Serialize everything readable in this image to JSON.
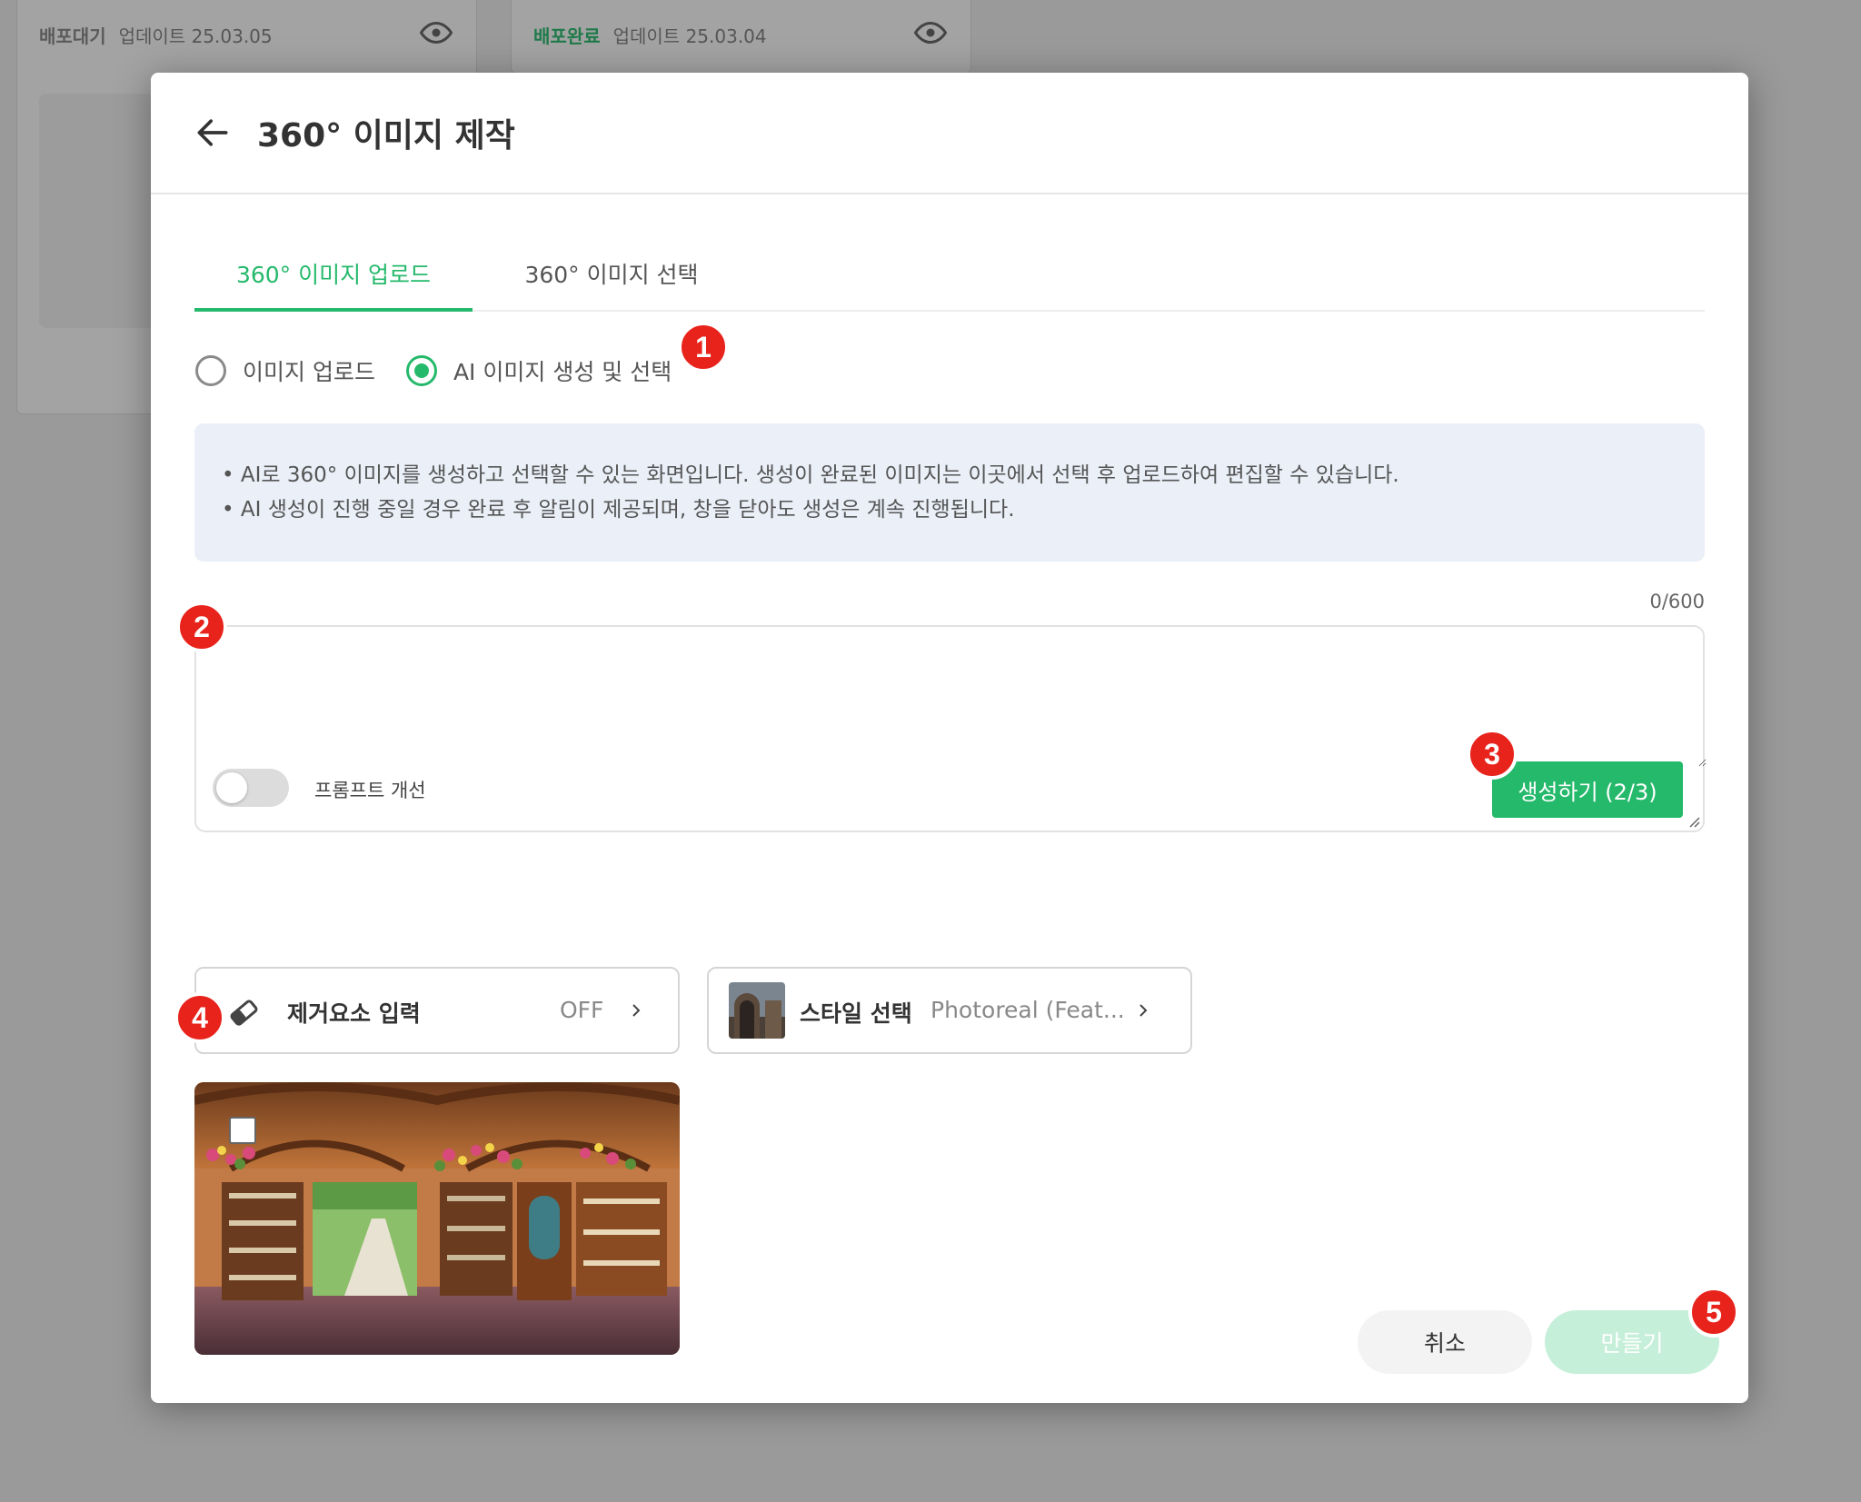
{
  "background": {
    "cards": [
      {
        "status": "배포대기",
        "status_color": "#5a5a5a",
        "date": "업데이트 25.03.05"
      },
      {
        "status": "배포완료",
        "status_color": "#1f7a4a",
        "date": "업데이트 25.03.04"
      }
    ]
  },
  "modal": {
    "title": "360° 이미지 제작",
    "tabs": [
      {
        "label": "360° 이미지 업로드",
        "active": true
      },
      {
        "label": "360° 이미지 선택",
        "active": false
      }
    ],
    "radio_options": [
      {
        "label": "이미지 업로드",
        "checked": false
      },
      {
        "label": "AI 이미지 생성 및 선택",
        "checked": true
      }
    ],
    "info_lines": [
      "• AI로 360° 이미지를 생성하고 선택할 수 있는 화면입니다. 생성이 완료된 이미지는 이곳에서 선택 후 업로드하여 편집할 수 있습니다.",
      "• AI 생성이 진행 중일 경우 완료 후 알림이 제공되며, 창을 닫아도 생성은 계속 진행됩니다."
    ],
    "prompt": {
      "value": "",
      "char_count": "0/600",
      "toggle_label": "프롬프트 개선",
      "toggle_on": false,
      "generate_label": "생성하기 (2/3)"
    },
    "remove_elements": {
      "label": "제거요소 입력",
      "value": "OFF",
      "icon": "eraser-icon"
    },
    "style_select": {
      "label": "스타일 선택",
      "value": "Photoreal (Feat..."
    },
    "generated_image": {
      "description_icon": "panorama-image",
      "selected": false
    },
    "cancel_label": "취소",
    "create_label": "만들기"
  },
  "markers": [
    "1",
    "2",
    "3",
    "4",
    "5"
  ],
  "colors": {
    "accent": "#25b96b",
    "accent_disabled": "#c6efd9",
    "info_bg": "#eaeff8",
    "marker_red": "#e8231c"
  }
}
